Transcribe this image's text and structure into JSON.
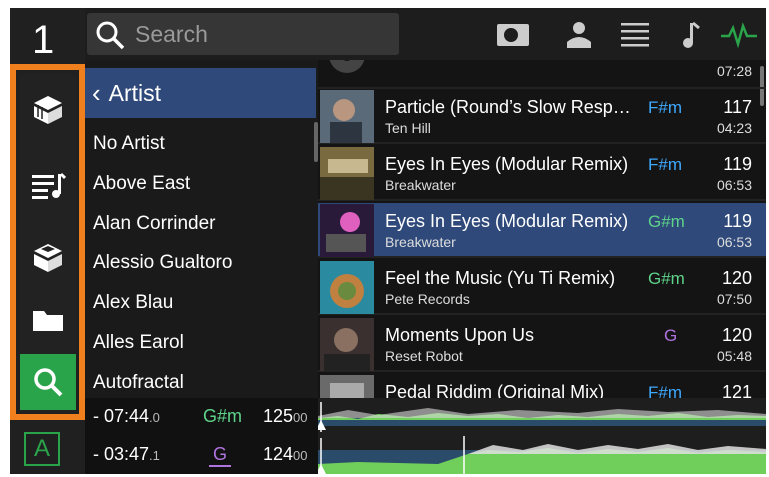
{
  "deck_number": "1",
  "search": {
    "placeholder": "Search"
  },
  "top_icons": [
    "prep-icon",
    "user-icon",
    "list-icon",
    "music-note-icon",
    "waveform-icon"
  ],
  "rail": {
    "items": [
      "engine-crate-icon",
      "playlist-icon",
      "collection-icon",
      "folder-icon",
      "search-icon"
    ],
    "mode_label": "A"
  },
  "browser": {
    "header": "Artist",
    "artists": [
      "No Artist",
      "Above East",
      "Alan Corrinder",
      "Alessio Gualtoro",
      "Alex Blau",
      "Alles Earol",
      "Autofractal"
    ]
  },
  "tracks": [
    {
      "title": "",
      "artist": "",
      "key": "",
      "bpm": "",
      "duration": "07:28",
      "key_color": "#3fa9ff"
    },
    {
      "title": "Particle (Round’s Slow Resp…",
      "artist": "Ten Hill",
      "key": "F#m",
      "bpm": "117",
      "duration": "04:23",
      "key_color": "#3fa9ff"
    },
    {
      "title": "Eyes In Eyes (Modular Remix)",
      "artist": "Breakwater",
      "key": "F#m",
      "bpm": "119",
      "duration": "06:53",
      "key_color": "#3fa9ff"
    },
    {
      "title": "Eyes In Eyes (Modular Remix)",
      "artist": "Breakwater",
      "key": "G#m",
      "bpm": "119",
      "duration": "06:53",
      "key_color": "#5ed38a",
      "selected": true
    },
    {
      "title": "Feel the Music (Yu Ti Remix)",
      "artist": "Pete Records",
      "key": "G#m",
      "bpm": "120",
      "duration": "07:50",
      "key_color": "#5ed38a"
    },
    {
      "title": "Moments Upon Us",
      "artist": "Reset Robot",
      "key": "G",
      "bpm": "120",
      "duration": "05:48",
      "key_color": "#b073e0"
    },
    {
      "title": "Pedal Riddim (Original Mix)",
      "artist": "",
      "key": "F#m",
      "bpm": "121",
      "duration": "",
      "key_color": "#3fa9ff"
    }
  ],
  "decks": [
    {
      "time": "- 07:44",
      "time_frac": ".0",
      "key": "G#m",
      "key_color": "#5ed38a",
      "bpm": "125",
      "bpm_frac": "00"
    },
    {
      "time": "- 03:47",
      "time_frac": ".1",
      "key": "G",
      "key_color": "#b073e0",
      "bpm": "124",
      "bpm_frac": "00"
    }
  ],
  "colors": {
    "accent_green": "#2aa44a",
    "orange_highlight": "#f0801e",
    "selection_blue": "#2f4a7a"
  }
}
